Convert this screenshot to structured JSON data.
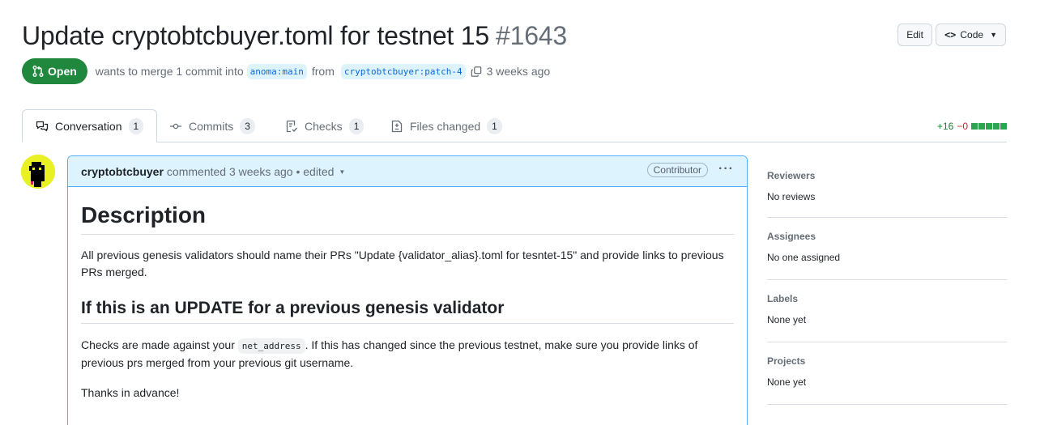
{
  "pr": {
    "title": "Update cryptobtcbuyer.toml for testnet 15",
    "number": "#1643",
    "state": "Open",
    "merge_text": "wants to merge 1 commit into",
    "base_branch": "anoma:main",
    "from_text": "from",
    "head_branch": "cryptobtcbuyer:patch-4",
    "time": "3 weeks ago"
  },
  "header_actions": {
    "edit": "Edit",
    "code": "Code"
  },
  "tabs": [
    {
      "label": "Conversation",
      "count": "1"
    },
    {
      "label": "Commits",
      "count": "3"
    },
    {
      "label": "Checks",
      "count": "1"
    },
    {
      "label": "Files changed",
      "count": "1"
    }
  ],
  "diffstat": {
    "additions": "+16",
    "deletions": "−0"
  },
  "comment": {
    "author": "cryptobtcbuyer",
    "action": "commented 3 weeks ago • edited",
    "badge": "Contributor",
    "heading": "Description",
    "para1": "All previous genesis validators should name their PRs \"Update {validator_alias}.toml for tesntet-15\" and provide links to previous PRs merged.",
    "subheading": "If this is an UPDATE for a previous genesis validator",
    "para2_before": "Checks are made against your",
    "para2_code": "net_address",
    "para2_after": ". If this has changed since the previous testnet, make sure you provide links of previous prs merged from your previous git username.",
    "para3": "Thanks in advance!"
  },
  "sidebar": {
    "reviewers": {
      "title": "Reviewers",
      "value": "No reviews"
    },
    "assignees": {
      "title": "Assignees",
      "value": "No one assigned"
    },
    "labels": {
      "title": "Labels",
      "value": "None yet"
    },
    "projects": {
      "title": "Projects",
      "value": "None yet"
    }
  },
  "colors": {
    "open_green": "#1f883d",
    "link_blue": "#0969da",
    "comment_head_bg": "#ddf4ff",
    "avatar_bg": "#e9f024"
  }
}
